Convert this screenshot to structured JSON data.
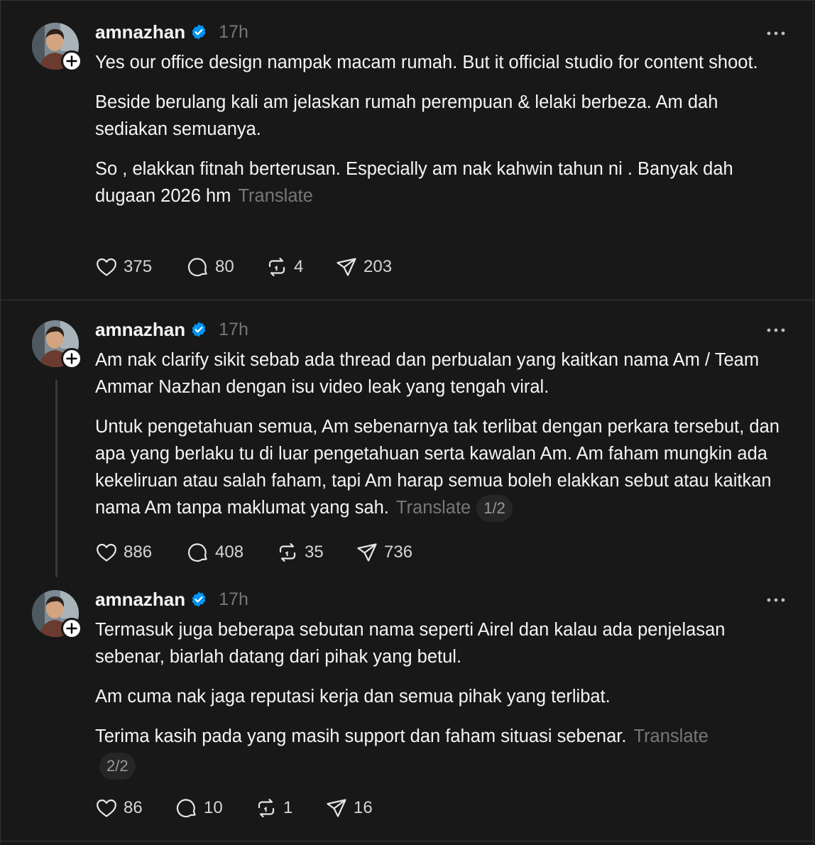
{
  "posts": [
    {
      "username": "amnazhan",
      "time": "17h",
      "paragraphs": [
        "Yes our office design nampak macam rumah. But it official studio for content shoot.",
        "Beside berulang kali am jelaskan rumah perempuan & lelaki berbeza. Am dah sediakan semuanya.",
        "So , elakkan fitnah berterusan. Especially am nak kahwin tahun ni . Banyak dah dugaan 2026 hm"
      ],
      "translate": "Translate",
      "pager": "",
      "likes": "375",
      "replies": "80",
      "reposts": "4",
      "shares": "203"
    },
    {
      "username": "amnazhan",
      "time": "17h",
      "paragraphs": [
        "Am nak clarify sikit sebab ada thread dan perbualan yang kaitkan nama Am / Team Ammar Nazhan dengan isu video leak yang tengah viral.",
        "Untuk pengetahuan semua, Am sebenarnya tak terlibat dengan perkara tersebut, dan apa yang berlaku tu di luar pengetahuan serta kawalan Am. Am faham mungkin ada kekeliruan atau salah faham, tapi Am harap semua boleh elakkan sebut atau kaitkan nama Am tanpa maklumat yang sah."
      ],
      "translate": "Translate",
      "pager": "1/2",
      "likes": "886",
      "replies": "408",
      "reposts": "35",
      "shares": "736"
    },
    {
      "username": "amnazhan",
      "time": "17h",
      "paragraphs": [
        "Termasuk juga beberapa sebutan nama seperti Airel dan kalau ada penjelasan sebenar, biarlah datang dari pihak yang betul.",
        "Am cuma nak jaga reputasi kerja dan semua pihak yang terlibat.",
        "Terima kasih pada yang masih support dan faham situasi sebenar."
      ],
      "translate": "Translate",
      "pager": "2/2",
      "likes": "86",
      "replies": "10",
      "reposts": "1",
      "shares": "16"
    }
  ],
  "colors": {
    "background": "#181818",
    "text": "#f3f5f7",
    "muted": "#777777",
    "verified": "#0095f6"
  },
  "icons": [
    "avatar-photo",
    "follow-plus-icon",
    "verified-badge-icon",
    "more-options-icon",
    "heart-icon",
    "comment-icon",
    "repost-icon",
    "share-icon"
  ]
}
